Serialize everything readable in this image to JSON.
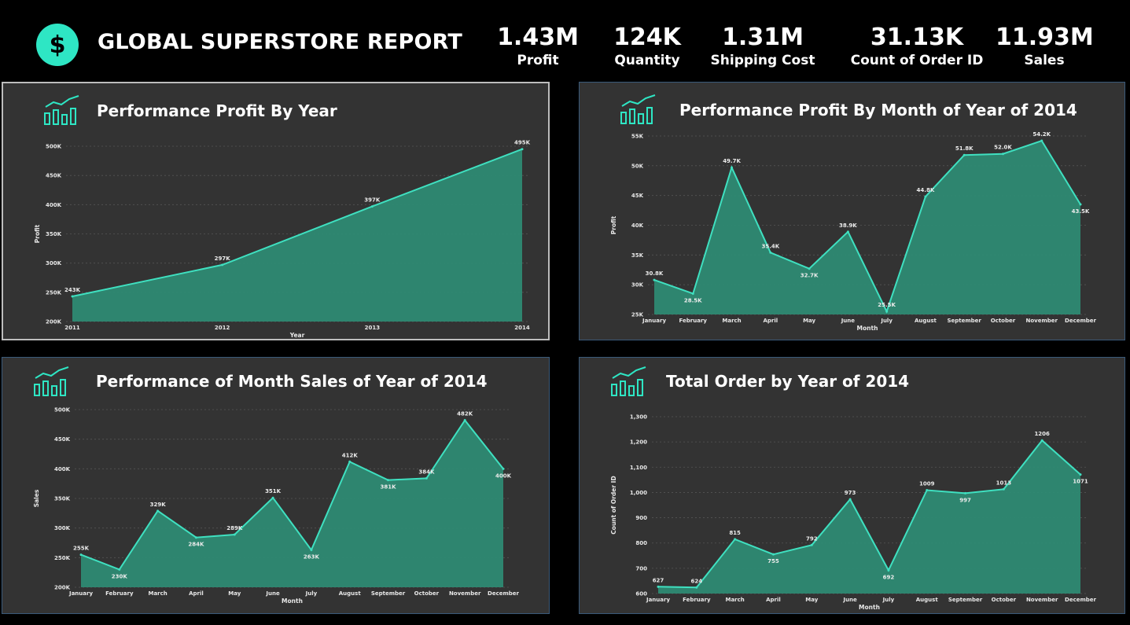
{
  "header": {
    "title": "GLOBAL SUPERSTORE REPORT",
    "logo_icon": "dollar-icon",
    "logo_glyph": "$",
    "accent": "#2ee6c4"
  },
  "kpis": [
    {
      "value": "1.43M",
      "label": "Profit"
    },
    {
      "value": "124K",
      "label": "Quantity"
    },
    {
      "value": "1.31M",
      "label": "Shipping Cost"
    },
    {
      "value": "31.13K",
      "label": "Count of Order ID"
    },
    {
      "value": "11.93M",
      "label": "Sales"
    }
  ],
  "panels": [
    {
      "title": "Performance Profit By Year",
      "icon": "bar-line-chart-icon"
    },
    {
      "title": "Performance Profit By Month of Year of 2014",
      "icon": "bar-line-chart-icon"
    },
    {
      "title": "Performance of Month Sales of Year of 2014",
      "icon": "bar-line-chart-icon"
    },
    {
      "title": "Total Order by Year of 2014",
      "icon": "bar-line-chart-icon"
    }
  ],
  "chart_data": [
    {
      "type": "area",
      "xlabel": "Year",
      "ylabel": "Profit",
      "categories": [
        "2011",
        "2012",
        "2013",
        "2014"
      ],
      "values": [
        243000,
        297000,
        397000,
        495000
      ],
      "labels": [
        "243K",
        "297K",
        "397K",
        "495K"
      ],
      "ylim": [
        200000,
        500000
      ],
      "yticks": [
        200000,
        250000,
        300000,
        350000,
        400000,
        450000,
        500000
      ],
      "yticklabels": [
        "200K",
        "250K",
        "300K",
        "350K",
        "400K",
        "450K",
        "500K"
      ],
      "fill": "#2e8a73",
      "line": "#3fe0c0",
      "grid": true
    },
    {
      "type": "area",
      "xlabel": "Month",
      "ylabel": "Profit",
      "categories": [
        "January",
        "February",
        "March",
        "April",
        "May",
        "June",
        "July",
        "August",
        "September",
        "October",
        "November",
        "December"
      ],
      "values": [
        30800,
        28500,
        49700,
        35400,
        32700,
        38900,
        25500,
        44800,
        51800,
        52000,
        54200,
        43500
      ],
      "labels": [
        "30.8K",
        "28.5K",
        "49.7K",
        "35.4K",
        "32.7K",
        "38.9K",
        "25.5K",
        "44.8K",
        "51.8K",
        "52.0K",
        "54.2K",
        "43.5K"
      ],
      "ylim": [
        25000,
        55000
      ],
      "yticks": [
        25000,
        30000,
        35000,
        40000,
        45000,
        50000,
        55000
      ],
      "yticklabels": [
        "25K",
        "30K",
        "35K",
        "40K",
        "45K",
        "50K",
        "55K"
      ],
      "fill": "#2e8a73",
      "line": "#3fe0c0",
      "grid": true
    },
    {
      "type": "area",
      "xlabel": "Month",
      "ylabel": "Sales",
      "categories": [
        "January",
        "February",
        "March",
        "April",
        "May",
        "June",
        "July",
        "August",
        "September",
        "October",
        "November",
        "December"
      ],
      "values": [
        255000,
        230000,
        329000,
        284000,
        289000,
        351000,
        263000,
        412000,
        381000,
        384000,
        482000,
        400000
      ],
      "labels": [
        "255K",
        "230K",
        "329K",
        "284K",
        "289K",
        "351K",
        "263K",
        "412K",
        "381K",
        "384K",
        "482K",
        "400K"
      ],
      "ylim": [
        200000,
        500000
      ],
      "yticks": [
        200000,
        250000,
        300000,
        350000,
        400000,
        450000,
        500000
      ],
      "yticklabels": [
        "200K",
        "250K",
        "300K",
        "350K",
        "400K",
        "450K",
        "500K"
      ],
      "fill": "#2e8a73",
      "line": "#3fe0c0",
      "grid": true
    },
    {
      "type": "area",
      "xlabel": "Month",
      "ylabel": "Count of Order ID",
      "categories": [
        "January",
        "February",
        "March",
        "April",
        "May",
        "June",
        "July",
        "August",
        "September",
        "October",
        "November",
        "December"
      ],
      "values": [
        627,
        624,
        815,
        755,
        792,
        973,
        692,
        1009,
        997,
        1013,
        1206,
        1071
      ],
      "labels": [
        "627",
        "624",
        "815",
        "755",
        "792",
        "973",
        "692",
        "1009",
        "997",
        "1013",
        "1206",
        "1071"
      ],
      "ylim": [
        600,
        1300
      ],
      "yticks": [
        600,
        700,
        800,
        900,
        1000,
        1100,
        1200,
        1300
      ],
      "yticklabels": [
        "600",
        "700",
        "800",
        "900",
        "1,000",
        "1,100",
        "1,200",
        "1,300"
      ],
      "fill": "#2e8a73",
      "line": "#3fe0c0",
      "grid": true
    }
  ]
}
